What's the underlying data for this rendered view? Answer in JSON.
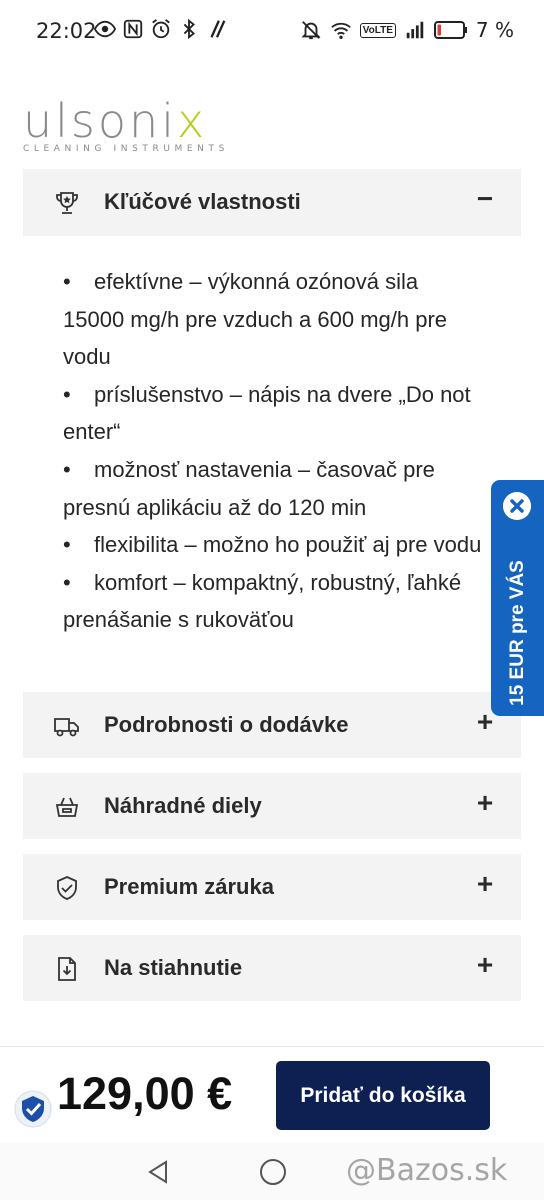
{
  "status_bar": {
    "time": "22:02",
    "network": "VoLTE",
    "battery": "7 %",
    "left_icons": [
      "eye-icon",
      "nfc-icon",
      "alarm-icon",
      "bluetooth-icon",
      "slash-icon"
    ],
    "right_icons": [
      "mute-icon",
      "wifi-icon",
      "volte-icon",
      "signal-icon",
      "battery-icon"
    ]
  },
  "logo": {
    "word": "ulsoni",
    "word_accent": "x",
    "tagline": "CLEANING INSTRUMENTS",
    "accent_color": "#b6cf1a"
  },
  "accordions": {
    "key_features": {
      "title": "Kľúčové vlastnosti",
      "toggle": "−",
      "icon": "trophy-icon",
      "items": [
        "efektívne – výkonná ozónová sila 15000 mg/h pre vzduch a 600 mg/h pre vodu",
        "príslušenstvo – nápis na dvere „Do not enter“",
        "možnosť nastavenia – časovač pre presnú aplikáciu až do 120 min",
        "flexibilita – možno ho použiť aj pre vodu",
        "komfort – kompaktný, robustný, ľahké prenášanie s rukoväťou"
      ]
    },
    "delivery": {
      "title": "Podrobnosti o dodávke",
      "toggle": "+",
      "icon": "truck-icon"
    },
    "spare_parts": {
      "title": "Náhradné diely",
      "toggle": "+",
      "icon": "basket-icon"
    },
    "warranty": {
      "title": "Premium záruka",
      "toggle": "+",
      "icon": "shield-icon"
    },
    "download": {
      "title": "Na stiahnutie",
      "toggle": "+",
      "icon": "download-file-icon"
    }
  },
  "side_tab": {
    "label": "15 EUR pre VÁS",
    "color": "#1565c0"
  },
  "purchase": {
    "price": "129,00 €",
    "add_to_cart": "Pridať do košíka",
    "button_color": "#0e1f52"
  },
  "watermark": "@Bazos.sk"
}
